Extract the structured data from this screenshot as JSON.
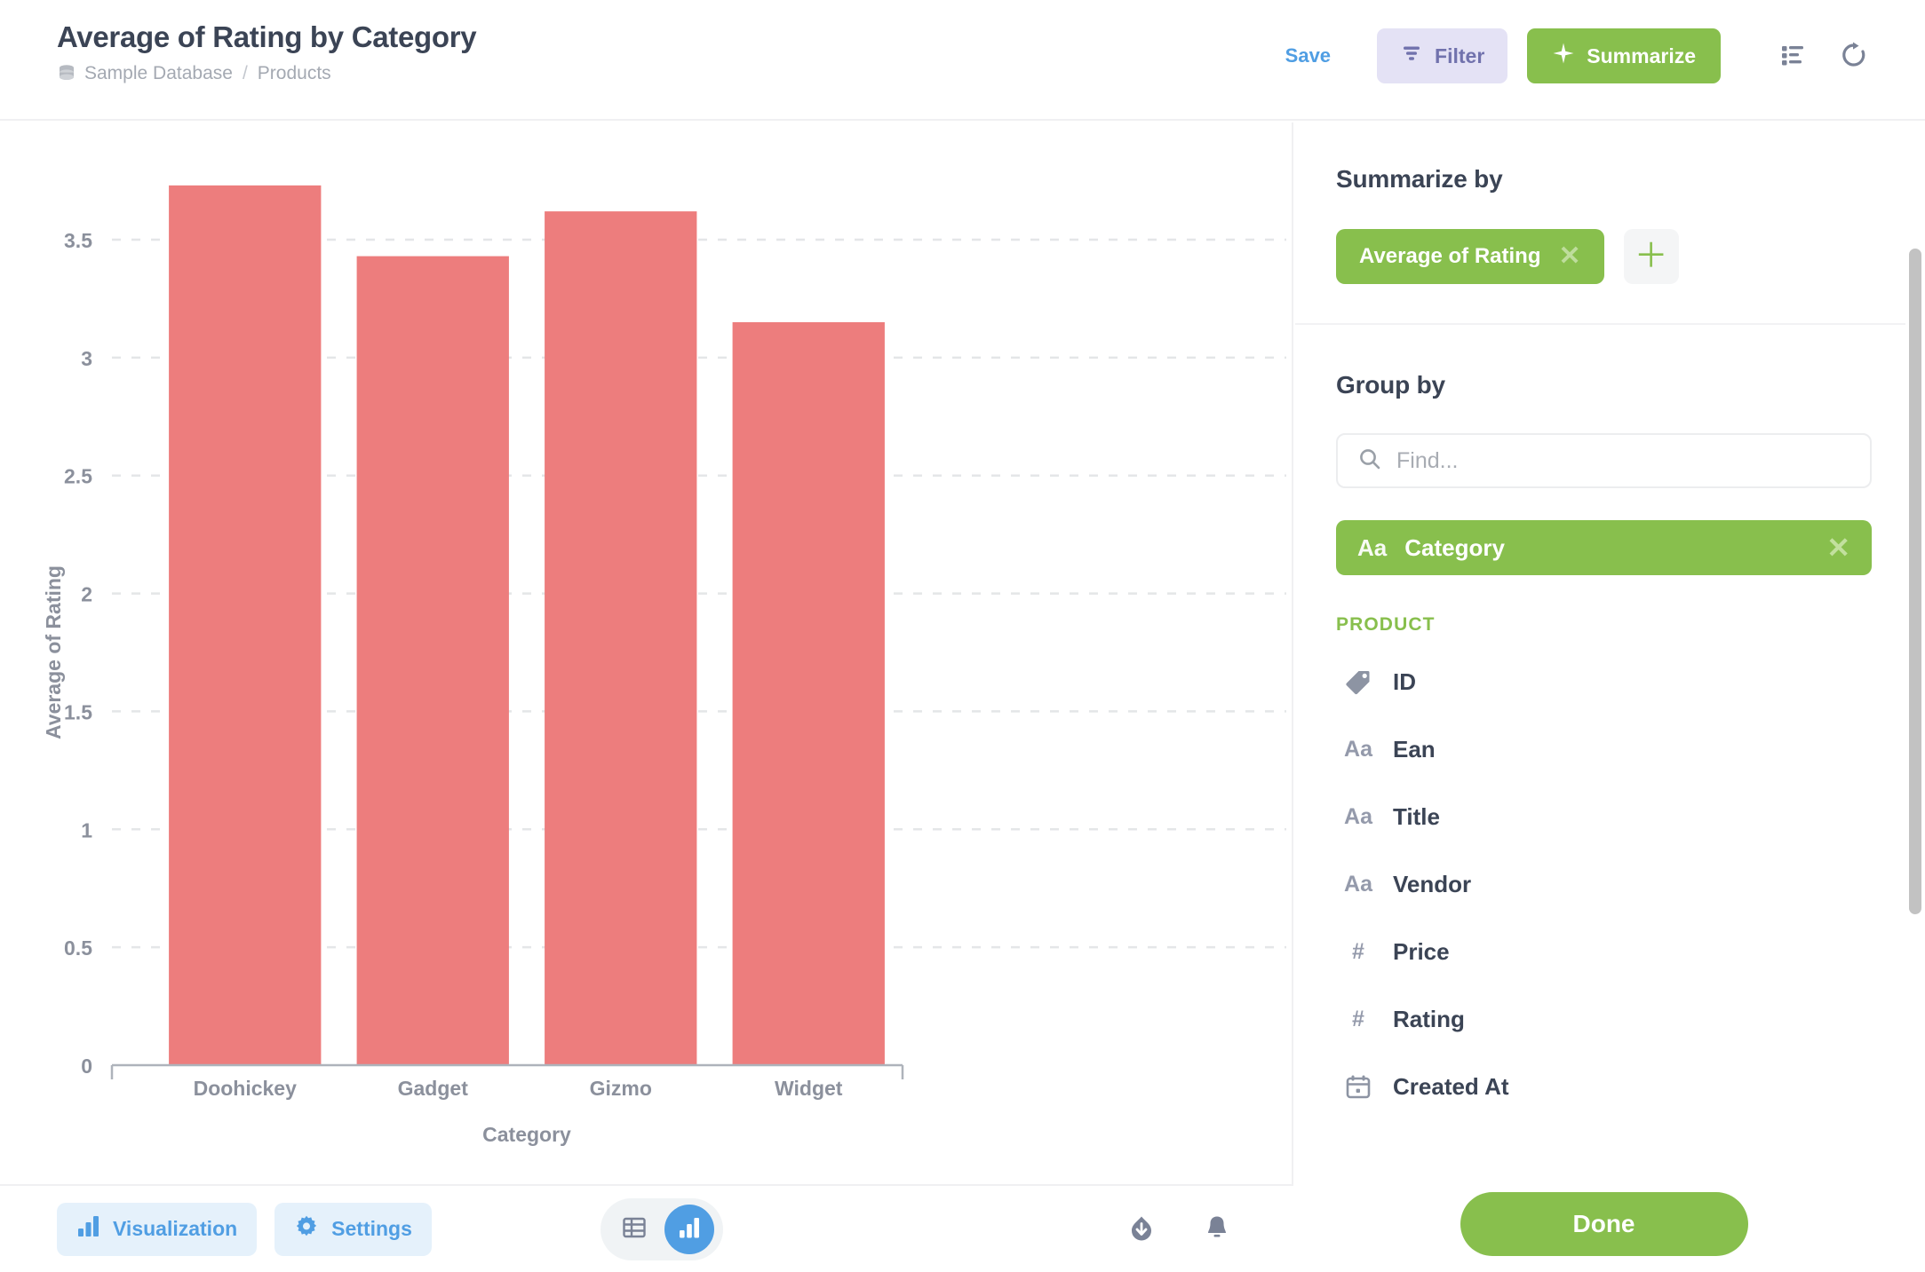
{
  "header": {
    "title": "Average of Rating by Category",
    "breadcrumb": {
      "database": "Sample Database",
      "separator": "/",
      "table": "Products",
      "db_icon": "database-icon"
    },
    "save_label": "Save",
    "filter_label": "Filter",
    "filter_icon": "filter-icon",
    "summarize_label": "Summarize",
    "summarize_icon": "sparkle-icon",
    "columns_icon": "column-settings-icon",
    "refresh_icon": "refresh-icon",
    "accent_green": "#88bf4d",
    "accent_blue": "#509ee3",
    "filter_bg": "#e4e2f5",
    "filter_fg": "#7172ad"
  },
  "chart_data": {
    "type": "bar",
    "title": "Average of Rating by Category",
    "categories": [
      "Doohickey",
      "Gadget",
      "Gizmo",
      "Widget"
    ],
    "values": [
      3.73,
      3.43,
      3.62,
      3.15
    ],
    "xlabel": "Category",
    "ylabel": "Average of Rating",
    "ylim": [
      0,
      3.73
    ],
    "yticks": [
      "0",
      "0.5",
      "1",
      "1.5",
      "2",
      "2.5",
      "3",
      "3.5"
    ],
    "ytick_values": [
      0,
      0.5,
      1,
      1.5,
      2,
      2.5,
      3,
      3.5
    ],
    "grid": true,
    "legend": "none",
    "bar_color": "#ed7d7d",
    "axis_color": "#aeb3bb",
    "grid_color": "#e4e6e8"
  },
  "footer": {
    "visualization_label": "Visualization",
    "visualization_icon": "bar-chart-icon",
    "settings_label": "Settings",
    "settings_icon": "gear-icon",
    "table_toggle_icon": "table-icon",
    "chart_toggle_icon": "bar-chart-icon",
    "active_toggle": "chart",
    "download_icon": "download-icon",
    "alert_icon": "bell-icon"
  },
  "sidebar": {
    "summarize": {
      "title": "Summarize by",
      "aggregation": {
        "label": "Average of Rating",
        "remove_icon": "close-icon"
      },
      "add_icon": "plus-icon"
    },
    "group_by": {
      "title": "Group by",
      "search_placeholder": "Find...",
      "search_value": "",
      "search_icon": "search-icon",
      "selected": {
        "type_icon": "Aa",
        "label": "Category",
        "remove_icon": "close-icon"
      },
      "table_header": "PRODUCT",
      "fields": [
        {
          "icon": "tag-icon",
          "glyph": "",
          "label": "ID"
        },
        {
          "icon": "text-icon",
          "glyph": "Aa",
          "label": "Ean"
        },
        {
          "icon": "text-icon",
          "glyph": "Aa",
          "label": "Title"
        },
        {
          "icon": "text-icon",
          "glyph": "Aa",
          "label": "Vendor"
        },
        {
          "icon": "number-icon",
          "glyph": "#",
          "label": "Price"
        },
        {
          "icon": "number-icon",
          "glyph": "#",
          "label": "Rating"
        },
        {
          "icon": "calendar-icon",
          "glyph": "",
          "label": "Created At"
        }
      ]
    },
    "done_label": "Done"
  }
}
